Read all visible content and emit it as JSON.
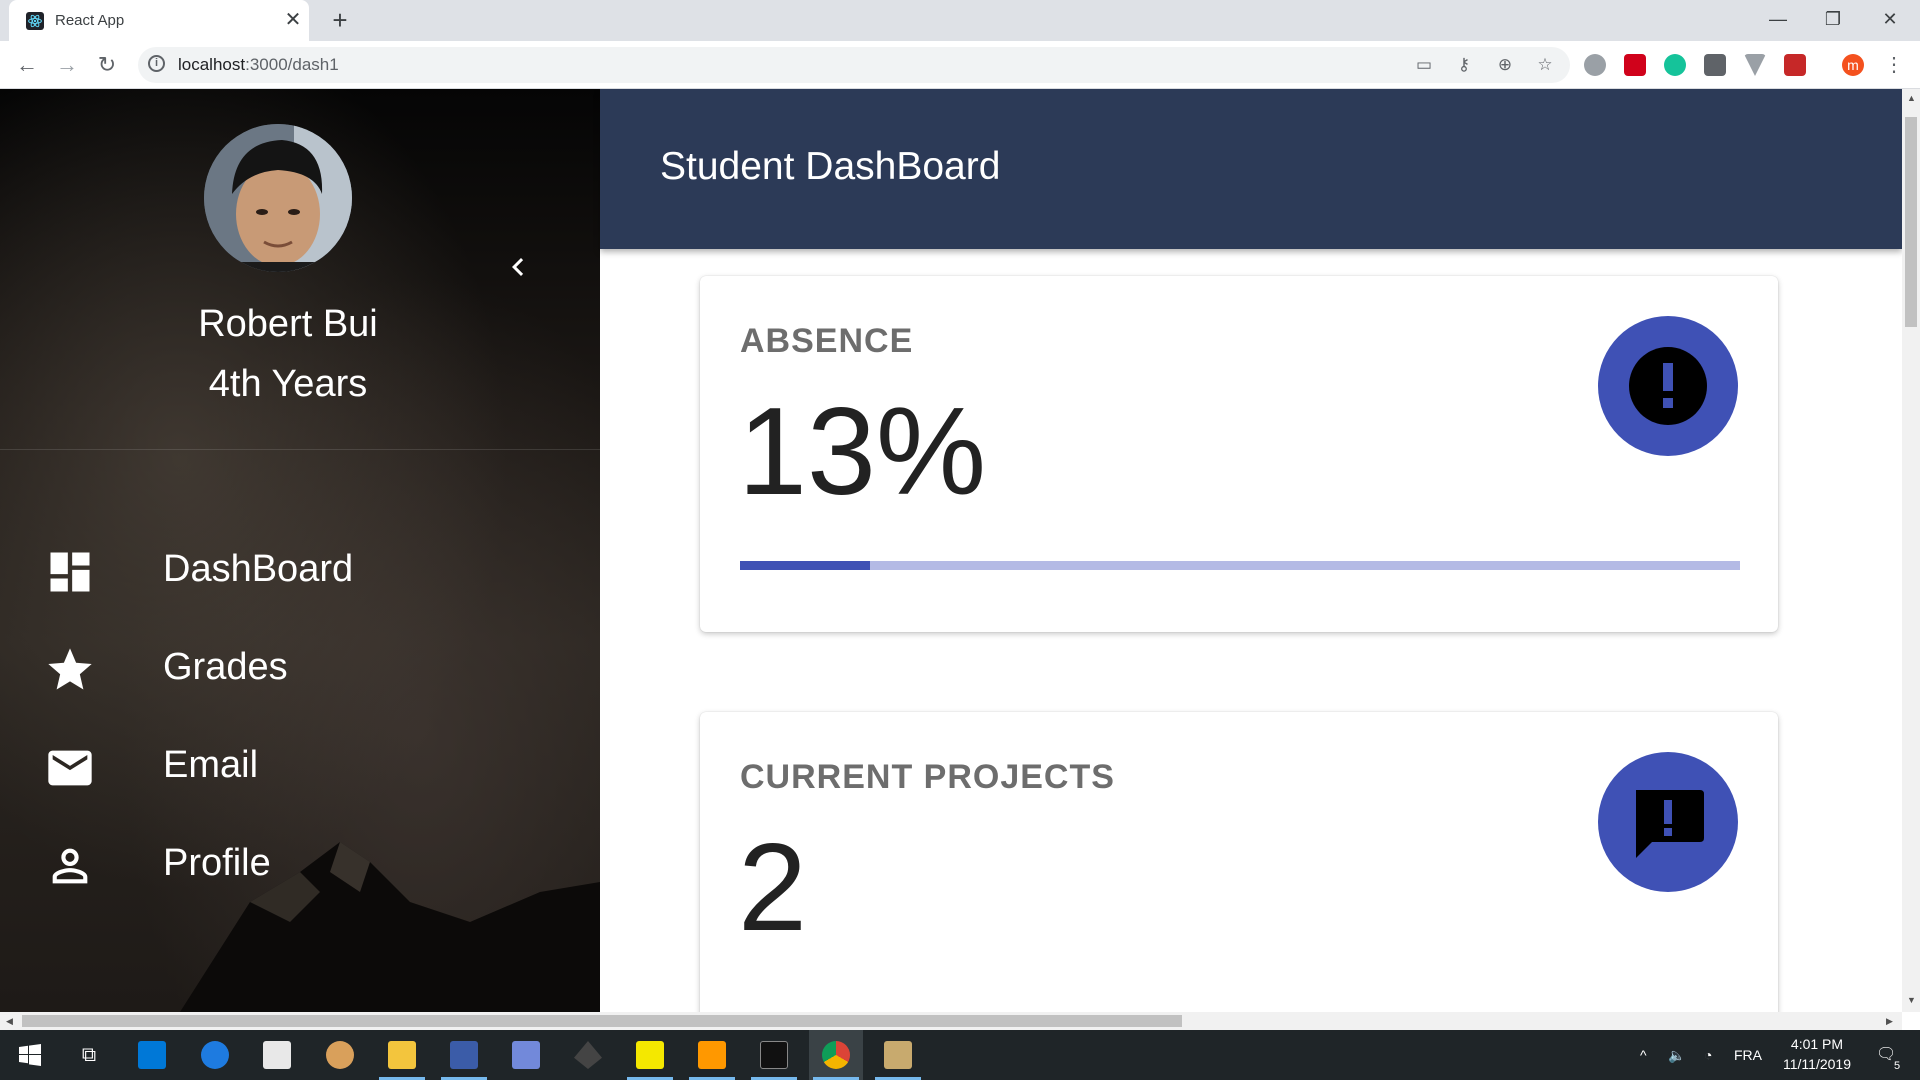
{
  "browser": {
    "tab_title": "React App",
    "tab_close": "✕",
    "new_tab": "+",
    "url_host": "localhost",
    "url_path": ":3000/dash1",
    "window_controls": [
      "—",
      "❐",
      "✕"
    ],
    "nav": {
      "back": "←",
      "forward": "→",
      "reload": "↻"
    },
    "profile_initial": "m"
  },
  "sidebar": {
    "user_name": "Robert Bui",
    "user_year": "4th Years",
    "items": [
      {
        "label": "DashBoard",
        "icon": "dashboard-icon"
      },
      {
        "label": "Grades",
        "icon": "star-icon"
      },
      {
        "label": "Email",
        "icon": "email-icon"
      },
      {
        "label": "Profile",
        "icon": "person-icon"
      }
    ]
  },
  "appbar": {
    "title": "Student DashBoard"
  },
  "cards": [
    {
      "label": "ABSENCE",
      "value": "13%",
      "progress": 0.13,
      "icon": "error-icon",
      "accent": "#3f51b5"
    },
    {
      "label": "CURRENT PROJECTS",
      "value": "2",
      "icon": "feedback-icon",
      "accent": "#3f51b5"
    }
  ],
  "taskbar": {
    "language": "FRA",
    "time": "4:01 PM",
    "date": "11/11/2019",
    "notification_count": "5"
  },
  "colors": {
    "appbar": "#2c3a57",
    "accent": "#3f51b5",
    "progress_track": "#b4bae5"
  }
}
